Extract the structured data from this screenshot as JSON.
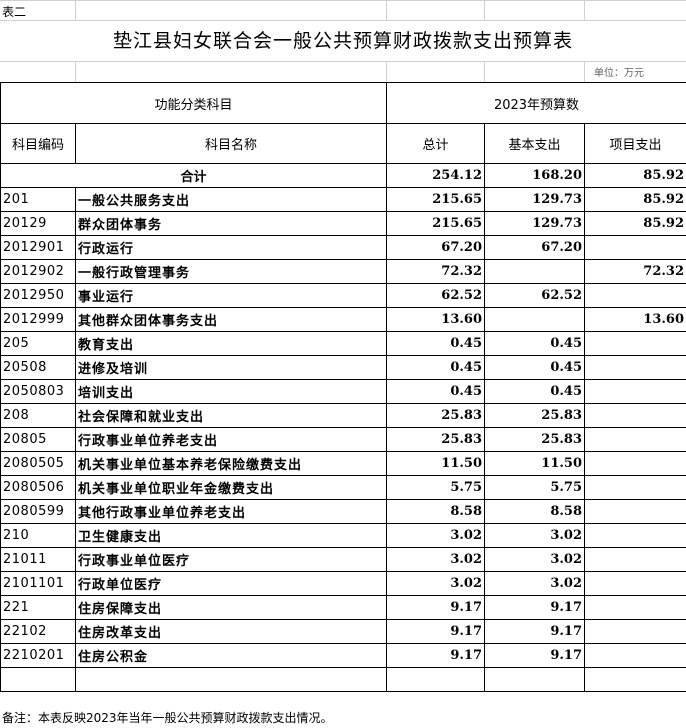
{
  "sheet_label": "表二",
  "title": "垫江县妇女联合会一般公共预算财政拨款支出预算表",
  "unit": "单位：万元",
  "header": {
    "functional_category": "功能分类科目",
    "budget_year": "2023年预算数",
    "code": "科目编码",
    "name": "科目名称",
    "total": "总计",
    "basic": "基本支出",
    "project": "项目支出"
  },
  "total_row": {
    "label": "合计",
    "total": "254.12",
    "basic": "168.20",
    "project": "85.92"
  },
  "rows": [
    {
      "code": "201",
      "name": "一般公共服务支出",
      "total": "215.65",
      "basic": "129.73",
      "project": "85.92"
    },
    {
      "code": "20129",
      "name": "群众团体事务",
      "total": "215.65",
      "basic": "129.73",
      "project": "85.92"
    },
    {
      "code": "2012901",
      "name": "行政运行",
      "total": "67.20",
      "basic": "67.20",
      "project": ""
    },
    {
      "code": "2012902",
      "name": "一般行政管理事务",
      "total": "72.32",
      "basic": "",
      "project": "72.32"
    },
    {
      "code": "2012950",
      "name": "事业运行",
      "total": "62.52",
      "basic": "62.52",
      "project": ""
    },
    {
      "code": "2012999",
      "name": "其他群众团体事务支出",
      "total": "13.60",
      "basic": "",
      "project": "13.60"
    },
    {
      "code": "205",
      "name": "教育支出",
      "total": "0.45",
      "basic": "0.45",
      "project": ""
    },
    {
      "code": "20508",
      "name": "进修及培训",
      "total": "0.45",
      "basic": "0.45",
      "project": ""
    },
    {
      "code": "2050803",
      "name": "培训支出",
      "total": "0.45",
      "basic": "0.45",
      "project": ""
    },
    {
      "code": "208",
      "name": "社会保障和就业支出",
      "total": "25.83",
      "basic": "25.83",
      "project": ""
    },
    {
      "code": "20805",
      "name": "行政事业单位养老支出",
      "total": "25.83",
      "basic": "25.83",
      "project": ""
    },
    {
      "code": "2080505",
      "name": "机关事业单位基本养老保险缴费支出",
      "total": "11.50",
      "basic": "11.50",
      "project": ""
    },
    {
      "code": "2080506",
      "name": "机关事业单位职业年金缴费支出",
      "total": "5.75",
      "basic": "5.75",
      "project": ""
    },
    {
      "code": "2080599",
      "name": "其他行政事业单位养老支出",
      "total": "8.58",
      "basic": "8.58",
      "project": ""
    },
    {
      "code": "210",
      "name": "卫生健康支出",
      "total": "3.02",
      "basic": "3.02",
      "project": ""
    },
    {
      "code": "21011",
      "name": "行政事业单位医疗",
      "total": "3.02",
      "basic": "3.02",
      "project": ""
    },
    {
      "code": "2101101",
      "name": "行政单位医疗",
      "total": "3.02",
      "basic": "3.02",
      "project": ""
    },
    {
      "code": "221",
      "name": "住房保障支出",
      "total": "9.17",
      "basic": "9.17",
      "project": ""
    },
    {
      "code": "22102",
      "name": "住房改革支出",
      "total": "9.17",
      "basic": "9.17",
      "project": ""
    },
    {
      "code": "2210201",
      "name": "住房公积金",
      "total": "9.17",
      "basic": "9.17",
      "project": ""
    }
  ],
  "note": "备注：本表反映2023年当年一般公共预算财政拨款支出情况。"
}
